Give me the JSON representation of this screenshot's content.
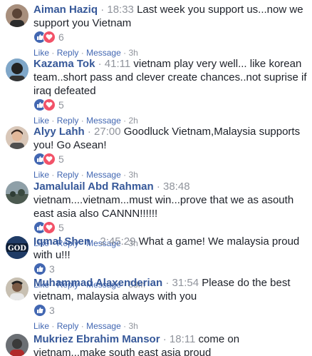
{
  "comments": [
    {
      "author": "Aiman Haziq",
      "time": "18:33",
      "text": "Last week you support us...now we support you Vietnam",
      "reactions": [
        "like",
        "love"
      ],
      "count": "6",
      "actions": {
        "like": "Like",
        "reply": "Reply",
        "message": "Message",
        "age": "3h"
      }
    },
    {
      "author": "Kazama Tok",
      "time": "41:11",
      "text": "vietnam play very well... like korean team..short pass and clever create chances..not suprise if iraq defeated",
      "reactions": [
        "like",
        "love"
      ],
      "count": "5",
      "actions": {
        "like": "Like",
        "reply": "Reply",
        "message": "Message",
        "age": "2h"
      }
    },
    {
      "author": "Alyy Lahh",
      "time": "27:00",
      "text": "Goodluck Vietnam,Malaysia supports you! Go Asean!",
      "reactions": [
        "like",
        "love"
      ],
      "count": "5",
      "actions": {
        "like": "Like",
        "reply": "Reply",
        "message": "Message",
        "age": "3h"
      }
    },
    {
      "author": "Jamalulail Abd Rahman",
      "time": "38:48",
      "text": "vietnam....vietnam...must win...prove that we as asouth east asia also CANNN!!!!!!",
      "reactions": [
        "like",
        "love"
      ],
      "count": "5",
      "actions": {
        "like": "Like",
        "reply": "Reply",
        "message": "Message",
        "age": "3h"
      }
    },
    {
      "author": "Iqmal Shen",
      "time": "2:45:29",
      "text": "What a game! We malaysia proud with u!!!",
      "reactions": [
        "like"
      ],
      "count": "3",
      "actions": {
        "like": "Like",
        "reply": "Reply",
        "message": "Message",
        "age": "53m"
      }
    },
    {
      "author": "Muhammad Alaxenderian",
      "time": "31:54",
      "text": "Please do the best vietnam, malaysia always with you",
      "reactions": [
        "like"
      ],
      "count": "3",
      "actions": {
        "like": "Like",
        "reply": "Reply",
        "message": "Message",
        "age": "3h"
      }
    },
    {
      "author": "Mukriez Ebrahim Mansor",
      "time": "18:11",
      "text": "come on vietnam...make south east asia proud",
      "reactions": [],
      "count": "",
      "actions": null
    }
  ],
  "avatar_labels": {
    "iqmal": "GOD"
  },
  "colors": {
    "author": "#365899",
    "link": "#4267b2",
    "meta": "#90949c",
    "like": "#4267b2",
    "love": "#f25268"
  }
}
